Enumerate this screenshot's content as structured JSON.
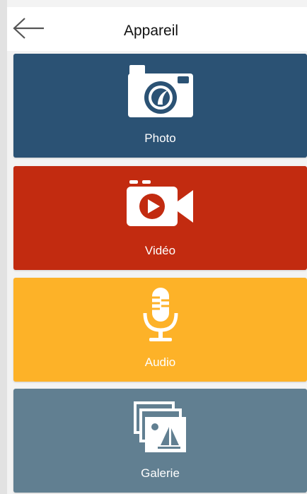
{
  "header": {
    "title": "Appareil",
    "back_icon": "arrow-left-icon"
  },
  "tiles": [
    {
      "label": "Photo",
      "icon": "camera-icon",
      "color": "#2b5274"
    },
    {
      "label": "Vidéo",
      "icon": "video-camera-icon",
      "color": "#c22b10"
    },
    {
      "label": "Audio",
      "icon": "microphone-icon",
      "color": "#fdb228"
    },
    {
      "label": "Galerie",
      "icon": "gallery-icon",
      "color": "#617f91"
    }
  ]
}
